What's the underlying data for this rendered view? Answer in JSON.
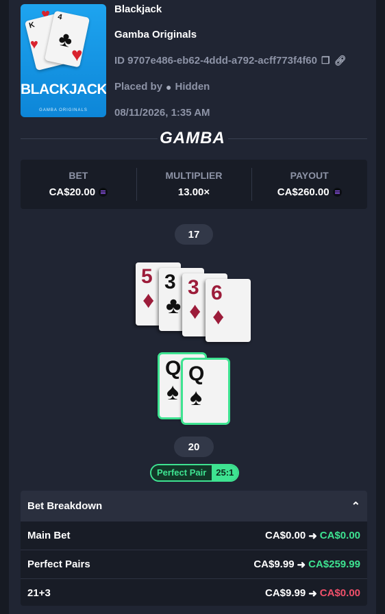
{
  "game": {
    "title": "Blackjack",
    "provider": "Gamba Originals",
    "bet_id": "ID 9707e486-eb62-4ddd-a792-acff773f4f60",
    "placed_by": "Placed by",
    "player": "Hidden",
    "date": "08/11/2026, 1:35 AM",
    "thumbnail_title": "BLACKJACK",
    "thumbnail_subtitle": "GAMBA ORIGINALS",
    "card_thumb_1_rank": "K",
    "card_thumb_2_rank": "4"
  },
  "brand": "GAMBA",
  "stats": [
    {
      "label": "BET",
      "value": "CA$20.00"
    },
    {
      "label": "MULTIPLIER",
      "value": "13.00×"
    },
    {
      "label": "PAYOUT",
      "value": "CA$260.00"
    }
  ],
  "dealer": {
    "total": "17",
    "cards": [
      {
        "rank": "5",
        "suit": "♦",
        "color": "red"
      },
      {
        "rank": "3",
        "suit": "♣",
        "color": "black"
      },
      {
        "rank": "3",
        "suit": "♦",
        "color": "red"
      },
      {
        "rank": "6",
        "suit": "♦",
        "color": "red"
      }
    ]
  },
  "player_hand": {
    "total": "20",
    "cards": [
      {
        "rank": "Q",
        "suit": "♠",
        "color": "black"
      },
      {
        "rank": "Q",
        "suit": "♠",
        "color": "black"
      }
    ]
  },
  "side_badge": {
    "label": "Perfect Pair",
    "multiplier": "25:1"
  },
  "breakdown": {
    "title": "Bet Breakdown",
    "rows": [
      {
        "name": "Main Bet",
        "from": "CA$0.00",
        "arrow": "➜",
        "to": "CA$0.00",
        "status": "win"
      },
      {
        "name": "Perfect Pairs",
        "from": "CA$9.99",
        "arrow": "➜",
        "to": "CA$259.99",
        "status": "win"
      },
      {
        "name": "21+3",
        "from": "CA$9.99",
        "arrow": "➜",
        "to": "CA$0.00",
        "status": "lose"
      }
    ]
  },
  "colors": {
    "win": "#3ee391",
    "lose": "#f0506a",
    "panel": "#202533"
  }
}
